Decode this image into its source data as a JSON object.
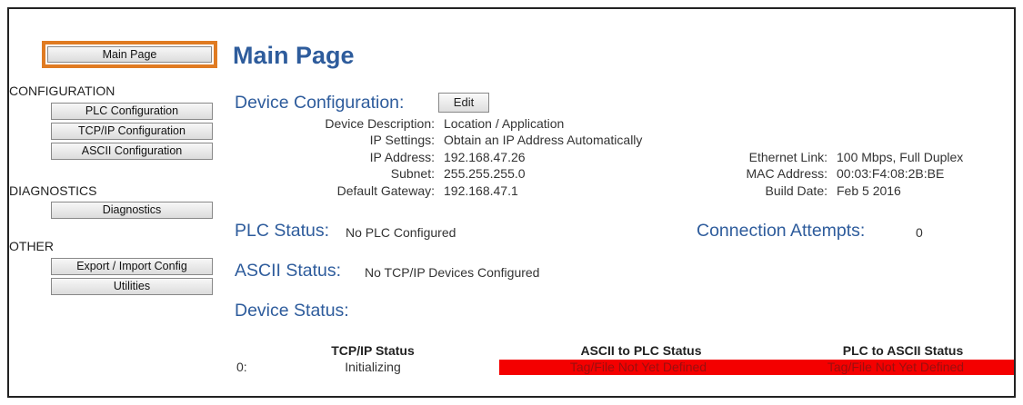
{
  "sidebar": {
    "main_page": "Main Page",
    "configuration_heading": "CONFIGURATION",
    "plc_config": "PLC Configuration",
    "tcpip_config": "TCP/IP Configuration",
    "ascii_config": "ASCII Configuration",
    "diagnostics_heading": "DIAGNOSTICS",
    "diagnostics": "Diagnostics",
    "other_heading": "OTHER",
    "export_import": "Export / Import Config",
    "utilities": "Utilities"
  },
  "main": {
    "title": "Main Page",
    "device_config_heading": "Device Configuration:",
    "edit_label": "Edit",
    "device_description_label": "Device Description:",
    "device_description_value": "Location / Application",
    "ip_settings_label": "IP Settings:",
    "ip_settings_value": "Obtain an IP Address Automatically",
    "ip_address_label": "IP Address:",
    "ip_address_value": "192.168.47.26",
    "subnet_label": "Subnet:",
    "subnet_value": "255.255.255.0",
    "gateway_label": "Default Gateway:",
    "gateway_value": "192.168.47.1",
    "ethernet_link_label": "Ethernet Link:",
    "ethernet_link_value": "100 Mbps, Full Duplex",
    "mac_label": "MAC Address:",
    "mac_value": "00:03:F4:08:2B:BE",
    "build_date_label": "Build Date:",
    "build_date_value": "Feb 5 2016",
    "plc_status_heading": "PLC Status:",
    "plc_status_value": "No PLC Configured",
    "connection_attempts_heading": "Connection Attempts:",
    "connection_attempts_value": "0",
    "ascii_status_heading": "ASCII Status:",
    "ascii_status_value": "No TCP/IP Devices Configured",
    "device_status_heading": "Device Status:"
  },
  "device_table": {
    "headers": [
      "TCP/IP Status",
      "ASCII to PLC Status",
      "PLC to ASCII Status"
    ],
    "rows": [
      {
        "index": "0:",
        "tcpip": "Initializing",
        "ascii_to_plc": "Tag/File Not Yet Defined",
        "plc_to_ascii": "Tag/File Not Yet Defined"
      }
    ]
  },
  "colors": {
    "accent_blue": "#2e5c9c",
    "highlight_orange": "#e07b22",
    "error_red": "#f40000"
  }
}
